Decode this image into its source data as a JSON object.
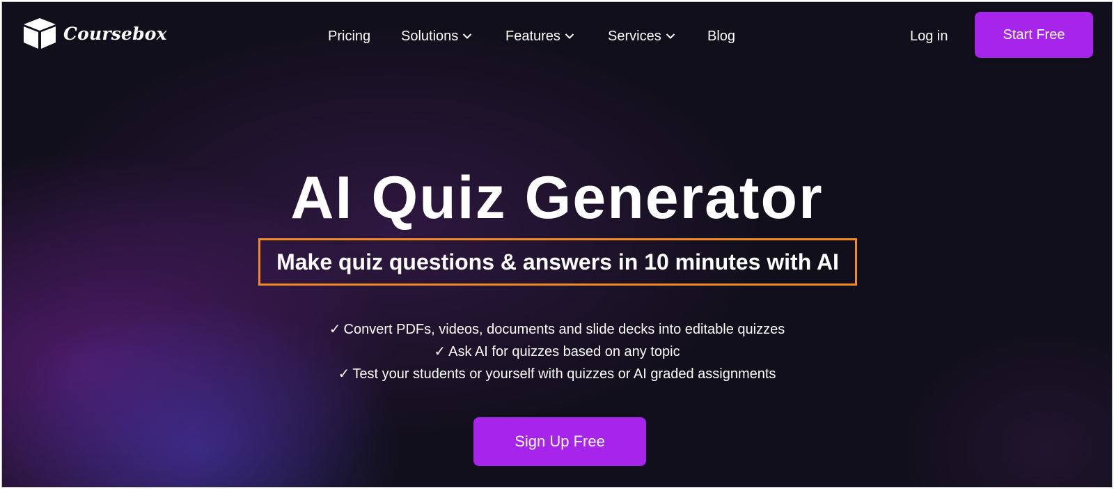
{
  "brand": {
    "name": "Coursebox",
    "logo_icon": "box-icon"
  },
  "nav": {
    "items": [
      {
        "label": "Pricing",
        "has_dropdown": false
      },
      {
        "label": "Solutions",
        "has_dropdown": true
      },
      {
        "label": "Features",
        "has_dropdown": true
      },
      {
        "label": "Services",
        "has_dropdown": true
      },
      {
        "label": "Blog",
        "has_dropdown": false
      }
    ],
    "login_label": "Log in",
    "start_label": "Start Free"
  },
  "hero": {
    "title": "AI Quiz Generator",
    "subtitle": "Make quiz questions & answers in 10 minutes with AI",
    "check_glyph": "✓",
    "features": [
      "Convert PDFs, videos, documents and slide decks into editable quizzes",
      "Ask AI for quizzes based on any topic",
      "Test your students or yourself with quizzes or AI graded assignments"
    ],
    "cta_label": "Sign Up Free"
  },
  "colors": {
    "accent": "#a724ea",
    "highlight_border": "#f08a24",
    "background": "#120f1c"
  }
}
